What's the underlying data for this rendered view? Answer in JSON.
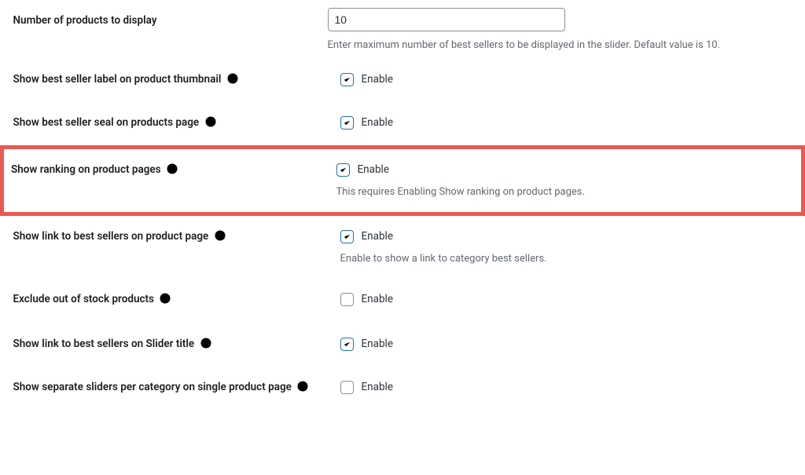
{
  "shared": {
    "enable_label": "Enable"
  },
  "rows": {
    "num_products": {
      "label": "Number of products to display",
      "value": "10",
      "description": "Enter maximum number of best sellers to be displayed in the slider. Default value is 10."
    },
    "label_thumb": {
      "label": "Show best seller label on product thumbnail"
    },
    "seal_page": {
      "label": "Show best seller seal on products page"
    },
    "ranking": {
      "label": "Show ranking on product pages",
      "description": "This requires Enabling Show ranking on product pages."
    },
    "link_product_page": {
      "label": "Show link to best sellers on product page",
      "description": "Enable to show a link to category best sellers."
    },
    "exclude_oos": {
      "label": "Exclude out of stock products"
    },
    "link_slider_title": {
      "label": "Show link to best sellers on Slider title"
    },
    "separate_sliders": {
      "label": "Show separate sliders per category on single product page"
    }
  }
}
